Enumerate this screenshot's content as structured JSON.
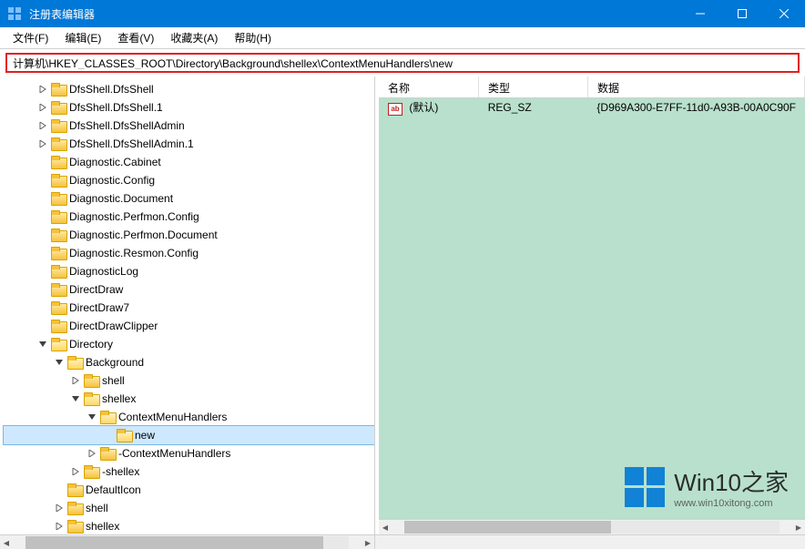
{
  "window": {
    "title": "注册表编辑器"
  },
  "menu": {
    "file": "文件(F)",
    "edit": "编辑(E)",
    "view": "查看(V)",
    "favorites": "收藏夹(A)",
    "help": "帮助(H)"
  },
  "address": {
    "path": "计算机\\HKEY_CLASSES_ROOT\\Directory\\Background\\shellex\\ContextMenuHandlers\\new"
  },
  "columns": {
    "name": "名称",
    "type": "类型",
    "data": "数据"
  },
  "values": [
    {
      "name": "(默认)",
      "type": "REG_SZ",
      "data": "{D969A300-E7FF-11d0-A93B-00A0C90F"
    }
  ],
  "tree": {
    "items": [
      {
        "label": "DfsShell.DfsShell",
        "depth": 2,
        "toggle": ">"
      },
      {
        "label": "DfsShell.DfsShell.1",
        "depth": 2,
        "toggle": ">"
      },
      {
        "label": "DfsShell.DfsShellAdmin",
        "depth": 2,
        "toggle": ">"
      },
      {
        "label": "DfsShell.DfsShellAdmin.1",
        "depth": 2,
        "toggle": ">"
      },
      {
        "label": "Diagnostic.Cabinet",
        "depth": 2,
        "toggle": ""
      },
      {
        "label": "Diagnostic.Config",
        "depth": 2,
        "toggle": ""
      },
      {
        "label": "Diagnostic.Document",
        "depth": 2,
        "toggle": ""
      },
      {
        "label": "Diagnostic.Perfmon.Config",
        "depth": 2,
        "toggle": ""
      },
      {
        "label": "Diagnostic.Perfmon.Document",
        "depth": 2,
        "toggle": ""
      },
      {
        "label": "Diagnostic.Resmon.Config",
        "depth": 2,
        "toggle": ""
      },
      {
        "label": "DiagnosticLog",
        "depth": 2,
        "toggle": ""
      },
      {
        "label": "DirectDraw",
        "depth": 2,
        "toggle": ""
      },
      {
        "label": "DirectDraw7",
        "depth": 2,
        "toggle": ""
      },
      {
        "label": "DirectDrawClipper",
        "depth": 2,
        "toggle": ""
      },
      {
        "label": "Directory",
        "depth": 2,
        "toggle": "v",
        "open": true
      },
      {
        "label": "Background",
        "depth": 3,
        "toggle": "v",
        "open": true
      },
      {
        "label": "shell",
        "depth": 4,
        "toggle": ">"
      },
      {
        "label": "shellex",
        "depth": 4,
        "toggle": "v",
        "open": true
      },
      {
        "label": "ContextMenuHandlers",
        "depth": 5,
        "toggle": "v",
        "open": true
      },
      {
        "label": "new",
        "depth": 6,
        "toggle": "",
        "selected": true,
        "open": true
      },
      {
        "label": "-ContextMenuHandlers",
        "depth": 5,
        "toggle": ">"
      },
      {
        "label": "-shellex",
        "depth": 4,
        "toggle": ">"
      },
      {
        "label": "DefaultIcon",
        "depth": 3,
        "toggle": ""
      },
      {
        "label": "shell",
        "depth": 3,
        "toggle": ">"
      },
      {
        "label": "shellex",
        "depth": 3,
        "toggle": ">"
      }
    ]
  },
  "watermark": {
    "big": "Win10之家",
    "small": "www.win10xitong.com"
  }
}
